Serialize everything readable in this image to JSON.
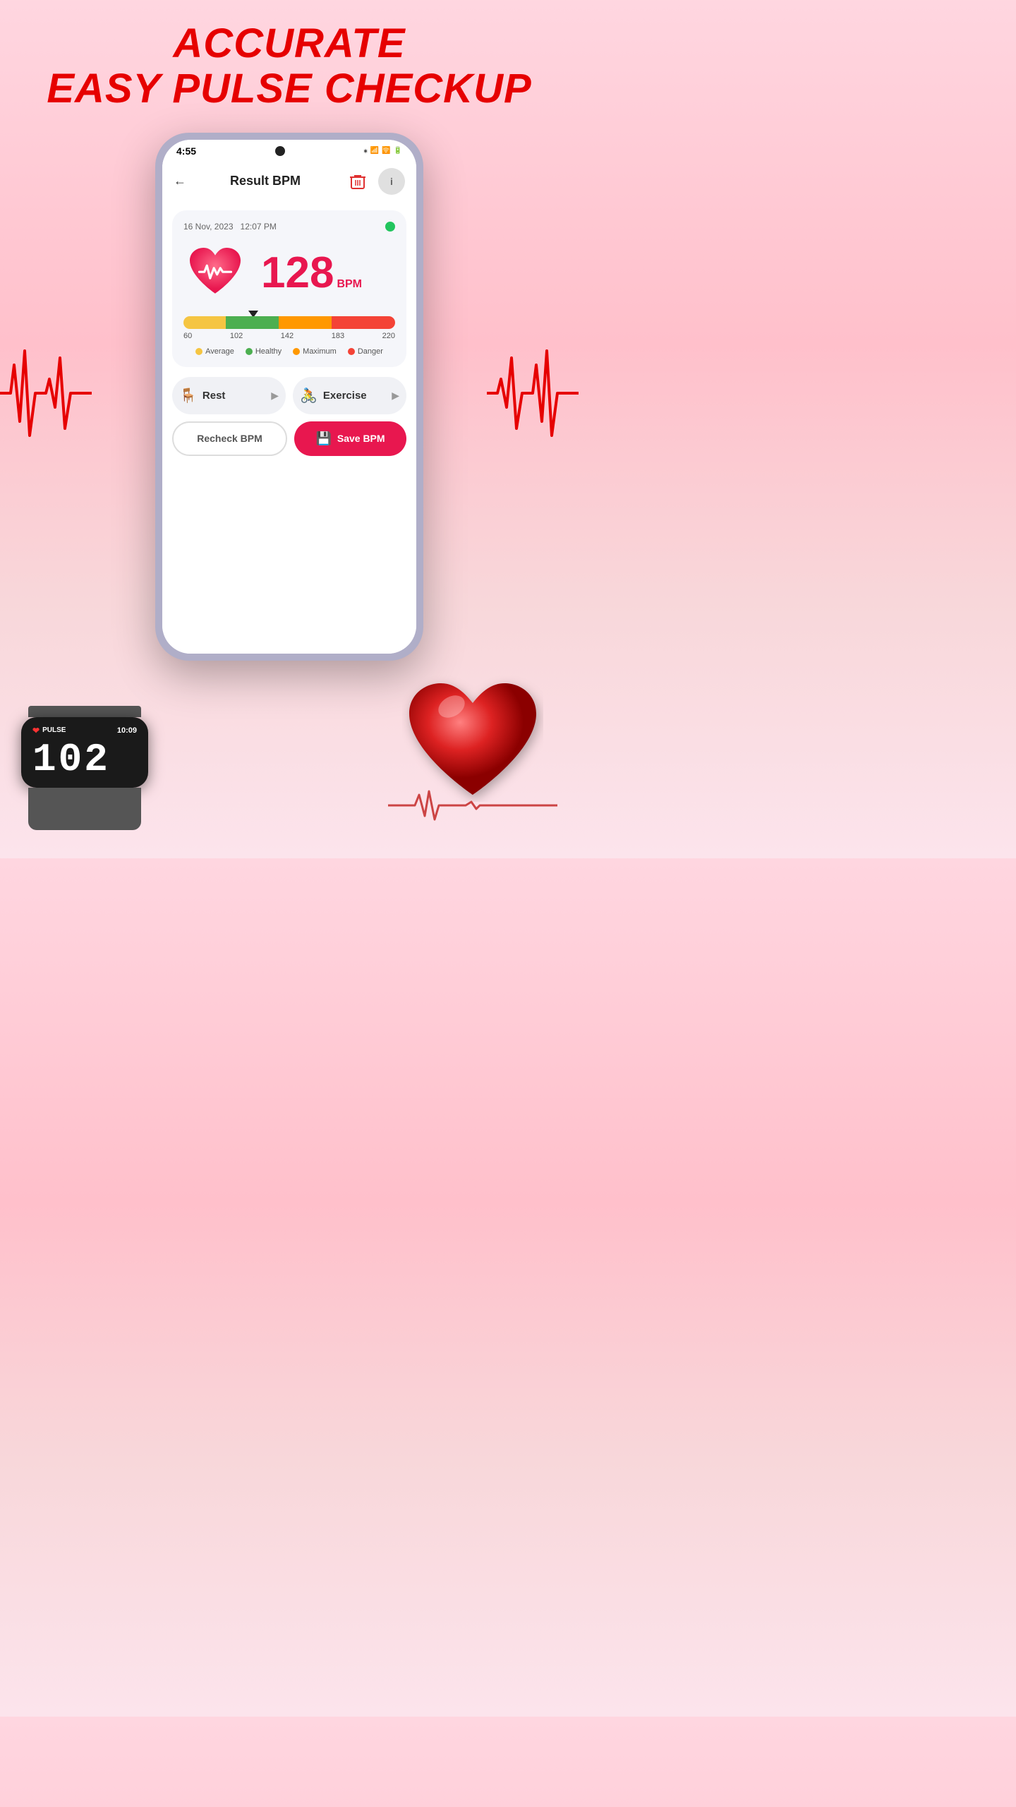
{
  "header": {
    "line1": "ACCURATE",
    "line2": "EASY PULSE CHECKUP"
  },
  "statusBar": {
    "time": "4:55",
    "icons": "🔵 📶 🔋"
  },
  "nav": {
    "title": "Result BPM",
    "backLabel": "←",
    "trashLabel": "🗑",
    "infoLabel": "i"
  },
  "resultCard": {
    "date": "16 Nov, 2023",
    "time": "12:07 PM",
    "bpm": "128",
    "bpmUnit": "BPM",
    "statusDot": "green"
  },
  "gaugeBar": {
    "labels": [
      "60",
      "102",
      "142",
      "183",
      "220"
    ],
    "indicatorPosition": "33"
  },
  "legend": [
    {
      "label": "Average",
      "color": "yellow"
    },
    {
      "label": "Healthy",
      "color": "green"
    },
    {
      "label": "Maximum",
      "color": "orange"
    },
    {
      "label": "Danger",
      "color": "red"
    }
  ],
  "actionButtons": [
    {
      "icon": "🪑",
      "label": "Rest"
    },
    {
      "icon": "🚴",
      "label": "Exercise"
    }
  ],
  "buttons": {
    "recheck": "Recheck BPM",
    "save": "Save BPM"
  },
  "smartwatch": {
    "pulse_label": "PULSE",
    "time": "10:09",
    "bpm": "102"
  }
}
